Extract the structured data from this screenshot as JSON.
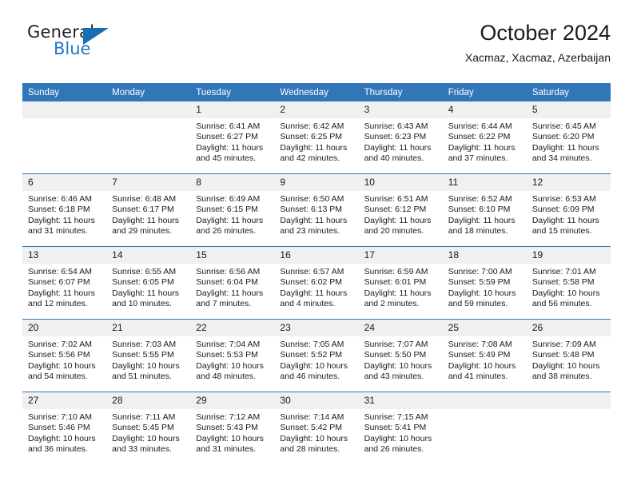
{
  "brand": {
    "name_part1": "General",
    "name_part2": "Blue",
    "accent_color": "#1a6cb5",
    "logo_icon": "triangle-icon"
  },
  "header": {
    "title": "October 2024",
    "subtitle": "Xacmaz, Xacmaz, Azerbaijan"
  },
  "calendar": {
    "header_color": "#3176b8",
    "daynum_band_color": "#f0f0f0",
    "weekday_headers": [
      "Sunday",
      "Monday",
      "Tuesday",
      "Wednesday",
      "Thursday",
      "Friday",
      "Saturday"
    ],
    "labels": {
      "sunrise": "Sunrise:",
      "sunset": "Sunset:",
      "daylight": "Daylight:"
    },
    "weeks": [
      [
        {
          "day": "",
          "sunrise": "",
          "sunset": "",
          "daylight": ""
        },
        {
          "day": "",
          "sunrise": "",
          "sunset": "",
          "daylight": ""
        },
        {
          "day": "1",
          "sunrise": "Sunrise: 6:41 AM",
          "sunset": "Sunset: 6:27 PM",
          "daylight": "Daylight: 11 hours and 45 minutes."
        },
        {
          "day": "2",
          "sunrise": "Sunrise: 6:42 AM",
          "sunset": "Sunset: 6:25 PM",
          "daylight": "Daylight: 11 hours and 42 minutes."
        },
        {
          "day": "3",
          "sunrise": "Sunrise: 6:43 AM",
          "sunset": "Sunset: 6:23 PM",
          "daylight": "Daylight: 11 hours and 40 minutes."
        },
        {
          "day": "4",
          "sunrise": "Sunrise: 6:44 AM",
          "sunset": "Sunset: 6:22 PM",
          "daylight": "Daylight: 11 hours and 37 minutes."
        },
        {
          "day": "5",
          "sunrise": "Sunrise: 6:45 AM",
          "sunset": "Sunset: 6:20 PM",
          "daylight": "Daylight: 11 hours and 34 minutes."
        }
      ],
      [
        {
          "day": "6",
          "sunrise": "Sunrise: 6:46 AM",
          "sunset": "Sunset: 6:18 PM",
          "daylight": "Daylight: 11 hours and 31 minutes."
        },
        {
          "day": "7",
          "sunrise": "Sunrise: 6:48 AM",
          "sunset": "Sunset: 6:17 PM",
          "daylight": "Daylight: 11 hours and 29 minutes."
        },
        {
          "day": "8",
          "sunrise": "Sunrise: 6:49 AM",
          "sunset": "Sunset: 6:15 PM",
          "daylight": "Daylight: 11 hours and 26 minutes."
        },
        {
          "day": "9",
          "sunrise": "Sunrise: 6:50 AM",
          "sunset": "Sunset: 6:13 PM",
          "daylight": "Daylight: 11 hours and 23 minutes."
        },
        {
          "day": "10",
          "sunrise": "Sunrise: 6:51 AM",
          "sunset": "Sunset: 6:12 PM",
          "daylight": "Daylight: 11 hours and 20 minutes."
        },
        {
          "day": "11",
          "sunrise": "Sunrise: 6:52 AM",
          "sunset": "Sunset: 6:10 PM",
          "daylight": "Daylight: 11 hours and 18 minutes."
        },
        {
          "day": "12",
          "sunrise": "Sunrise: 6:53 AM",
          "sunset": "Sunset: 6:09 PM",
          "daylight": "Daylight: 11 hours and 15 minutes."
        }
      ],
      [
        {
          "day": "13",
          "sunrise": "Sunrise: 6:54 AM",
          "sunset": "Sunset: 6:07 PM",
          "daylight": "Daylight: 11 hours and 12 minutes."
        },
        {
          "day": "14",
          "sunrise": "Sunrise: 6:55 AM",
          "sunset": "Sunset: 6:05 PM",
          "daylight": "Daylight: 11 hours and 10 minutes."
        },
        {
          "day": "15",
          "sunrise": "Sunrise: 6:56 AM",
          "sunset": "Sunset: 6:04 PM",
          "daylight": "Daylight: 11 hours and 7 minutes."
        },
        {
          "day": "16",
          "sunrise": "Sunrise: 6:57 AM",
          "sunset": "Sunset: 6:02 PM",
          "daylight": "Daylight: 11 hours and 4 minutes."
        },
        {
          "day": "17",
          "sunrise": "Sunrise: 6:59 AM",
          "sunset": "Sunset: 6:01 PM",
          "daylight": "Daylight: 11 hours and 2 minutes."
        },
        {
          "day": "18",
          "sunrise": "Sunrise: 7:00 AM",
          "sunset": "Sunset: 5:59 PM",
          "daylight": "Daylight: 10 hours and 59 minutes."
        },
        {
          "day": "19",
          "sunrise": "Sunrise: 7:01 AM",
          "sunset": "Sunset: 5:58 PM",
          "daylight": "Daylight: 10 hours and 56 minutes."
        }
      ],
      [
        {
          "day": "20",
          "sunrise": "Sunrise: 7:02 AM",
          "sunset": "Sunset: 5:56 PM",
          "daylight": "Daylight: 10 hours and 54 minutes."
        },
        {
          "day": "21",
          "sunrise": "Sunrise: 7:03 AM",
          "sunset": "Sunset: 5:55 PM",
          "daylight": "Daylight: 10 hours and 51 minutes."
        },
        {
          "day": "22",
          "sunrise": "Sunrise: 7:04 AM",
          "sunset": "Sunset: 5:53 PM",
          "daylight": "Daylight: 10 hours and 48 minutes."
        },
        {
          "day": "23",
          "sunrise": "Sunrise: 7:05 AM",
          "sunset": "Sunset: 5:52 PM",
          "daylight": "Daylight: 10 hours and 46 minutes."
        },
        {
          "day": "24",
          "sunrise": "Sunrise: 7:07 AM",
          "sunset": "Sunset: 5:50 PM",
          "daylight": "Daylight: 10 hours and 43 minutes."
        },
        {
          "day": "25",
          "sunrise": "Sunrise: 7:08 AM",
          "sunset": "Sunset: 5:49 PM",
          "daylight": "Daylight: 10 hours and 41 minutes."
        },
        {
          "day": "26",
          "sunrise": "Sunrise: 7:09 AM",
          "sunset": "Sunset: 5:48 PM",
          "daylight": "Daylight: 10 hours and 38 minutes."
        }
      ],
      [
        {
          "day": "27",
          "sunrise": "Sunrise: 7:10 AM",
          "sunset": "Sunset: 5:46 PM",
          "daylight": "Daylight: 10 hours and 36 minutes."
        },
        {
          "day": "28",
          "sunrise": "Sunrise: 7:11 AM",
          "sunset": "Sunset: 5:45 PM",
          "daylight": "Daylight: 10 hours and 33 minutes."
        },
        {
          "day": "29",
          "sunrise": "Sunrise: 7:12 AM",
          "sunset": "Sunset: 5:43 PM",
          "daylight": "Daylight: 10 hours and 31 minutes."
        },
        {
          "day": "30",
          "sunrise": "Sunrise: 7:14 AM",
          "sunset": "Sunset: 5:42 PM",
          "daylight": "Daylight: 10 hours and 28 minutes."
        },
        {
          "day": "31",
          "sunrise": "Sunrise: 7:15 AM",
          "sunset": "Sunset: 5:41 PM",
          "daylight": "Daylight: 10 hours and 26 minutes."
        },
        {
          "day": "",
          "sunrise": "",
          "sunset": "",
          "daylight": ""
        },
        {
          "day": "",
          "sunrise": "",
          "sunset": "",
          "daylight": ""
        }
      ]
    ]
  }
}
